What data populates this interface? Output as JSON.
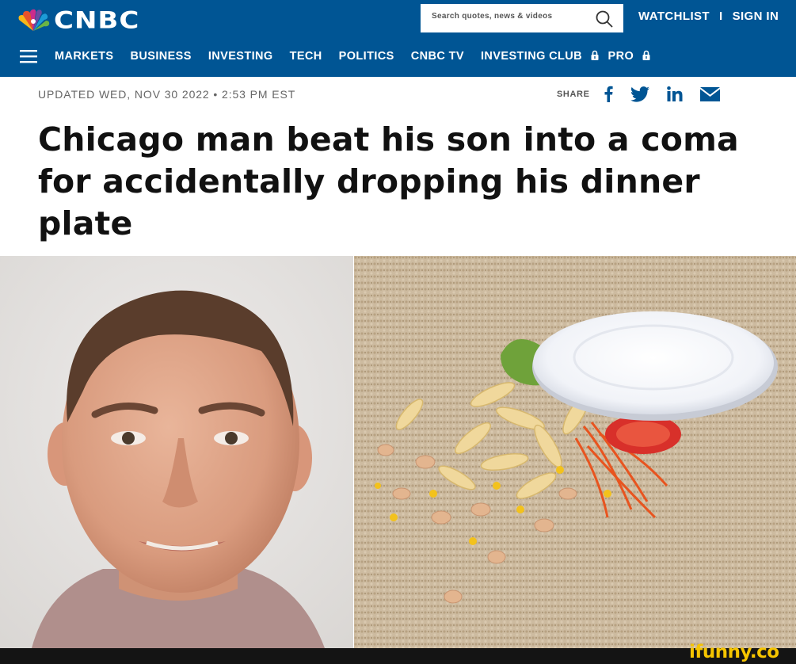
{
  "header": {
    "logo_text": "CNBC",
    "search_placeholder": "Search quotes, news & videos",
    "watchlist": "WATCHLIST",
    "separator": "I",
    "sign_in": "SIGN IN"
  },
  "nav": {
    "items": [
      "MARKETS",
      "BUSINESS",
      "INVESTING",
      "TECH",
      "POLITICS",
      "CNBC TV",
      "INVESTING CLUB",
      "PRO"
    ]
  },
  "article": {
    "updated": "UPDATED WED, NOV 30 2022 • 2:53 PM EST",
    "share_label": "SHARE",
    "headline": "Chicago man beat his son into a coma for accidentally dropping his dinner plate"
  },
  "share_icons": [
    "facebook-icon",
    "twitter-icon",
    "linkedin-icon",
    "email-icon"
  ],
  "images": {
    "left": "portrait of a man",
    "right": "spilled pasta plate on carpet"
  },
  "watermark": "ifunny.co",
  "colors": {
    "brand_blue": "#005594",
    "text": "#111111",
    "watermark": "#f5c400"
  }
}
